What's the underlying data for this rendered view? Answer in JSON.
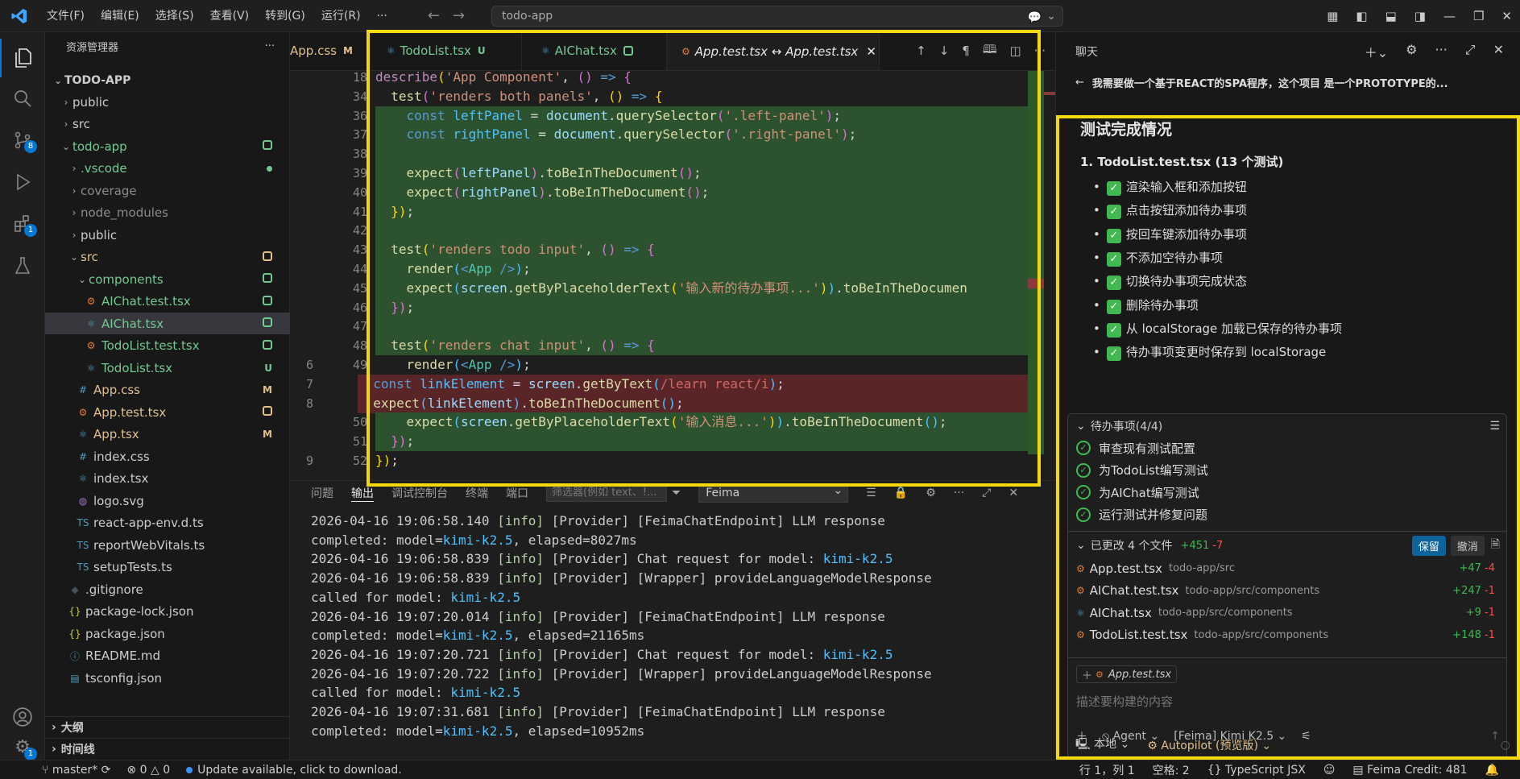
{
  "titlebar": {
    "menu": [
      "文件(F)",
      "编辑(E)",
      "选择(S)",
      "查看(V)",
      "转到(G)",
      "运行(R)",
      "···"
    ],
    "search": "todo-app"
  },
  "activity": {
    "scm_badge": "8",
    "ext_badge": "1",
    "settings_badge": "1"
  },
  "explorer": {
    "title": "资源管理器",
    "root": "TODO-APP",
    "rows": [
      {
        "label": "public",
        "kind": "folder",
        "depth": 1,
        "open": false
      },
      {
        "label": "src",
        "kind": "folder",
        "depth": 1,
        "open": false
      },
      {
        "label": "todo-app",
        "kind": "folder",
        "depth": 1,
        "open": true,
        "color": "green",
        "status": "sq"
      },
      {
        "label": ".vscode",
        "kind": "folder",
        "depth": 2,
        "open": false,
        "color": "green",
        "status": "dot"
      },
      {
        "label": "coverage",
        "kind": "folder",
        "depth": 2,
        "open": false,
        "color": "dim"
      },
      {
        "label": "node_modules",
        "kind": "folder",
        "depth": 2,
        "open": false,
        "color": "dim"
      },
      {
        "label": "public",
        "kind": "folder",
        "depth": 2,
        "open": false
      },
      {
        "label": "src",
        "kind": "folder",
        "depth": 2,
        "open": true,
        "color": "orange",
        "status": "sqo"
      },
      {
        "label": "components",
        "kind": "folder",
        "depth": 3,
        "open": true,
        "color": "green",
        "status": "sq"
      },
      {
        "label": "AIChat.test.tsx",
        "kind": "test",
        "depth": 4,
        "color": "green",
        "status": "sq"
      },
      {
        "label": "AIChat.tsx",
        "kind": "react",
        "depth": 4,
        "color": "green",
        "status": "sq",
        "selected": true
      },
      {
        "label": "TodoList.test.tsx",
        "kind": "test",
        "depth": 4,
        "color": "green",
        "status": "sq"
      },
      {
        "label": "TodoList.tsx",
        "kind": "react",
        "depth": 4,
        "color": "green",
        "status": "U"
      },
      {
        "label": "App.css",
        "kind": "css",
        "depth": 3,
        "color": "orange",
        "status": "M"
      },
      {
        "label": "App.test.tsx",
        "kind": "test",
        "depth": 3,
        "color": "orange",
        "status": "sqo"
      },
      {
        "label": "App.tsx",
        "kind": "react",
        "depth": 3,
        "color": "orange",
        "status": "M"
      },
      {
        "label": "index.css",
        "kind": "css",
        "depth": 3
      },
      {
        "label": "index.tsx",
        "kind": "react",
        "depth": 3
      },
      {
        "label": "logo.svg",
        "kind": "svg",
        "depth": 3
      },
      {
        "label": "react-app-env.d.ts",
        "kind": "ts",
        "depth": 3
      },
      {
        "label": "reportWebVitals.ts",
        "kind": "ts",
        "depth": 3
      },
      {
        "label": "setupTests.ts",
        "kind": "ts",
        "depth": 3
      },
      {
        "label": ".gitignore",
        "kind": "git",
        "depth": 2
      },
      {
        "label": "package-lock.json",
        "kind": "json",
        "depth": 2
      },
      {
        "label": "package.json",
        "kind": "json",
        "depth": 2
      },
      {
        "label": "README.md",
        "kind": "info",
        "depth": 2
      },
      {
        "label": "tsconfig.json",
        "kind": "tsj",
        "depth": 2
      }
    ],
    "outline": "大纲",
    "timeline": "时间线"
  },
  "tabs": {
    "app_css": "App.css",
    "app_css_mod": "M",
    "todolist": "TodoList.tsx",
    "todolist_mod": "U",
    "aichat": "AIChat.tsx",
    "active": "App.test.tsx ↔ App.test.tsx"
  },
  "editor": {
    "lines": [
      {
        "old": "",
        "new": "18",
        "kind": "ctx",
        "html": "<span class='k'>describe</span><span class='p'>(</span><span class='s'>'App Component'</span>, <span class='b'>()</span> <span class='kw'>=&gt;</span> <span class='b'>{</span>"
      },
      {
        "old": "",
        "new": "34",
        "kind": "ctx",
        "html": "  <span class='f'>test</span><span class='b'>(</span><span class='s'>'renders both panels'</span>, <span class='p'>()</span> <span class='kw'>=&gt;</span> <span class='p'>{</span>"
      },
      {
        "old": "",
        "new": "36",
        "kind": "add",
        "html": "    <span class='kw'>const</span> <span class='c'>leftPanel</span> = <span class='v'>document</span>.<span class='f'>querySelector</span><span class='b'>(</span><span class='s'>'.left-panel'</span><span class='b'>)</span>;"
      },
      {
        "old": "",
        "new": "37",
        "kind": "add",
        "html": "    <span class='kw'>const</span> <span class='c'>rightPanel</span> = <span class='v'>document</span>.<span class='f'>querySelector</span><span class='b'>(</span><span class='s'>'.right-panel'</span><span class='b'>)</span>;"
      },
      {
        "old": "",
        "new": "38",
        "kind": "add",
        "html": ""
      },
      {
        "old": "",
        "new": "39",
        "kind": "add",
        "html": "    <span class='f'>expect</span><span class='b'>(</span><span class='v'>leftPanel</span><span class='b'>)</span>.<span class='f'>toBeInTheDocument</span><span class='b'>()</span>;"
      },
      {
        "old": "",
        "new": "40",
        "kind": "add",
        "html": "    <span class='f'>expect</span><span class='b'>(</span><span class='v'>rightPanel</span><span class='b'>)</span>.<span class='f'>toBeInTheDocument</span><span class='b'>()</span>;"
      },
      {
        "old": "",
        "new": "41",
        "kind": "add",
        "html": "  <span class='p'>})</span>;"
      },
      {
        "old": "",
        "new": "42",
        "kind": "add",
        "html": ""
      },
      {
        "old": "",
        "new": "43",
        "kind": "add",
        "html": "  <span class='f'>test</span><span class='p'>(</span><span class='s'>'renders todo input'</span>, <span class='b'>()</span> <span class='kw'>=&gt;</span> <span class='b'>{</span>"
      },
      {
        "old": "",
        "new": "44",
        "kind": "add",
        "html": "    <span class='f'>render</span><span class='c'>(</span><span class='kw'>&lt;</span><span class='t'>App</span> <span class='kw'>/&gt;</span><span class='c'>)</span>;"
      },
      {
        "old": "",
        "new": "45",
        "kind": "add",
        "html": "    <span class='f'>expect</span><span class='c'>(</span><span class='v'>screen</span>.<span class='f'>getByPlaceholderText</span><span class='p'>(</span><span class='s'>'输入新的待办事项...'</span><span class='p'>)</span><span class='c'>)</span>.<span class='f'>toBeInTheDocumen</span>"
      },
      {
        "old": "",
        "new": "46",
        "kind": "add",
        "html": "  <span class='b'>})</span>;"
      },
      {
        "old": "",
        "new": "47",
        "kind": "add",
        "html": ""
      },
      {
        "old": "",
        "new": "48",
        "kind": "add",
        "html": "  <span class='f'>test</span><span class='p'>(</span><span class='s'>'renders chat input'</span>, <span class='b'>()</span> <span class='kw'>=&gt;</span> <span class='b'>{</span>"
      },
      {
        "old": "6",
        "new": "49",
        "kind": "ctx",
        "html": "    <span class='f'>render</span><span class='c'>(</span><span class='kw'>&lt;</span><span class='t'>App</span> <span class='kw'>/&gt;</span><span class='c'>)</span>;"
      },
      {
        "old": "7",
        "new": "",
        "kind": "del",
        "html": "  <span class='kw'>const</span> <span class='c'>linkElement</span> = <span class='v'>screen</span>.<span class='f'>getByText</span><span class='c'>(</span><span class='rx'>/learn react/i</span><span class='c'>)</span>;"
      },
      {
        "old": "8",
        "new": "",
        "kind": "del",
        "html": "  <span class='f'>expect</span><span class='c'>(</span><span class='v'>linkElement</span><span class='c'>)</span>.<span class='f'>toBeInTheDocument</span><span class='c'>()</span>;"
      },
      {
        "old": "",
        "new": "50",
        "kind": "add",
        "html": "    <span class='f'>expect</span><span class='c'>(</span><span class='v'>screen</span>.<span class='f'>getByPlaceholderText</span><span class='p'>(</span><span class='s'>'输入消息...'</span><span class='p'>)</span><span class='c'>)</span>.<span class='f'>toBeInTheDocument</span><span class='c'>()</span>;"
      },
      {
        "old": "",
        "new": "51",
        "kind": "add",
        "html": "  <span class='b'>})</span>;"
      },
      {
        "old": "9",
        "new": "52",
        "kind": "ctx",
        "html": "<span class='p'>})</span>;"
      }
    ]
  },
  "panel": {
    "tabs": [
      "问题",
      "输出",
      "调试控制台",
      "终端",
      "端口"
    ],
    "filter_placeholder": "筛选器(例如 text、!...",
    "channel": "Feima",
    "log": [
      {
        "pre": "2026-04-16 19:06:58.140 ",
        "lvl": "[info]",
        "post": " [Provider] [FeimaChatEndpoint] LLM response",
        "model": "",
        "tail": ""
      },
      {
        "pre": "completed: model=",
        "lvl": "",
        "post": "",
        "model": "kimi-k2.5",
        "tail": ", elapsed=8027ms"
      },
      {
        "pre": "2026-04-16 19:06:58.839 ",
        "lvl": "[info]",
        "post": " [Provider] Chat request for model: ",
        "model": "kimi-k2.5",
        "tail": ""
      },
      {
        "pre": "2026-04-16 19:06:58.839 ",
        "lvl": "[info]",
        "post": " [Provider] [Wrapper] provideLanguageModelResponse",
        "model": "",
        "tail": ""
      },
      {
        "pre": "called for model: ",
        "lvl": "",
        "post": "",
        "model": "kimi-k2.5",
        "tail": ""
      },
      {
        "pre": "2026-04-16 19:07:20.014 ",
        "lvl": "[info]",
        "post": " [Provider] [FeimaChatEndpoint] LLM response",
        "model": "",
        "tail": ""
      },
      {
        "pre": "completed: model=",
        "lvl": "",
        "post": "",
        "model": "kimi-k2.5",
        "tail": ", elapsed=21165ms"
      },
      {
        "pre": "2026-04-16 19:07:20.721 ",
        "lvl": "[info]",
        "post": " [Provider] Chat request for model: ",
        "model": "kimi-k2.5",
        "tail": ""
      },
      {
        "pre": "2026-04-16 19:07:20.722 ",
        "lvl": "[info]",
        "post": " [Provider] [Wrapper] provideLanguageModelResponse",
        "model": "",
        "tail": ""
      },
      {
        "pre": "called for model: ",
        "lvl": "",
        "post": "",
        "model": "kimi-k2.5",
        "tail": ""
      },
      {
        "pre": "2026-04-16 19:07:31.681 ",
        "lvl": "[info]",
        "post": " [Provider] [FeimaChatEndpoint] LLM response",
        "model": "",
        "tail": ""
      },
      {
        "pre": "completed: model=",
        "lvl": "",
        "post": "",
        "model": "kimi-k2.5",
        "tail": ", elapsed=10952ms"
      }
    ]
  },
  "chat": {
    "title": "聊天",
    "request": "我需要做一个基于REACT的SPA程序，这个项目 是一个PROTOTYPE的...",
    "heading": "测试完成情况",
    "subheading": "1. TodoList.test.tsx (13 个测试)",
    "items": [
      "渲染输入框和添加按钮",
      "点击按钮添加待办事项",
      "按回车键添加待办事项",
      "不添加空待办事项",
      "切换待办事项完成状态",
      "删除待办事项",
      "从 localStorage 加载已保存的待办事项",
      "待办事项变更时保存到 localStorage"
    ],
    "todos_title": "待办事项(4/4)",
    "todos": [
      "审查现有测试配置",
      "为TodoList编写测试",
      "为AIChat编写测试",
      "运行测试并修复问题"
    ],
    "changed_title": "已更改 4 个文件",
    "changed_add": "+451",
    "changed_del": "-7",
    "keep": "保留",
    "undo": "撤消",
    "files": [
      {
        "name": "App.test.tsx",
        "path": "todo-app/src",
        "add": "+47",
        "del": "-4",
        "kind": "test"
      },
      {
        "name": "AIChat.test.tsx",
        "path": "todo-app/src/components",
        "add": "+247",
        "del": "-1",
        "kind": "test"
      },
      {
        "name": "AIChat.tsx",
        "path": "todo-app/src/components",
        "add": "+9",
        "del": "-1",
        "kind": "react"
      },
      {
        "name": "TodoList.test.tsx",
        "path": "todo-app/src/components",
        "add": "+148",
        "del": "-1",
        "kind": "test"
      }
    ],
    "attachment": "App.test.tsx",
    "placeholder": "描述要构建的内容",
    "mode": "Agent",
    "model": "[Feima] Kimi K2.5",
    "location": "本地",
    "autopilot": "Autopilot (预览版)"
  },
  "status": {
    "branch": "master*",
    "errors": "0",
    "warnings": "0",
    "update": "Update available, click to download.",
    "position": "行 1，列 1",
    "spaces": "空格: 2",
    "lang": "TypeScript JSX",
    "credit": "Feima Credit: 481"
  }
}
